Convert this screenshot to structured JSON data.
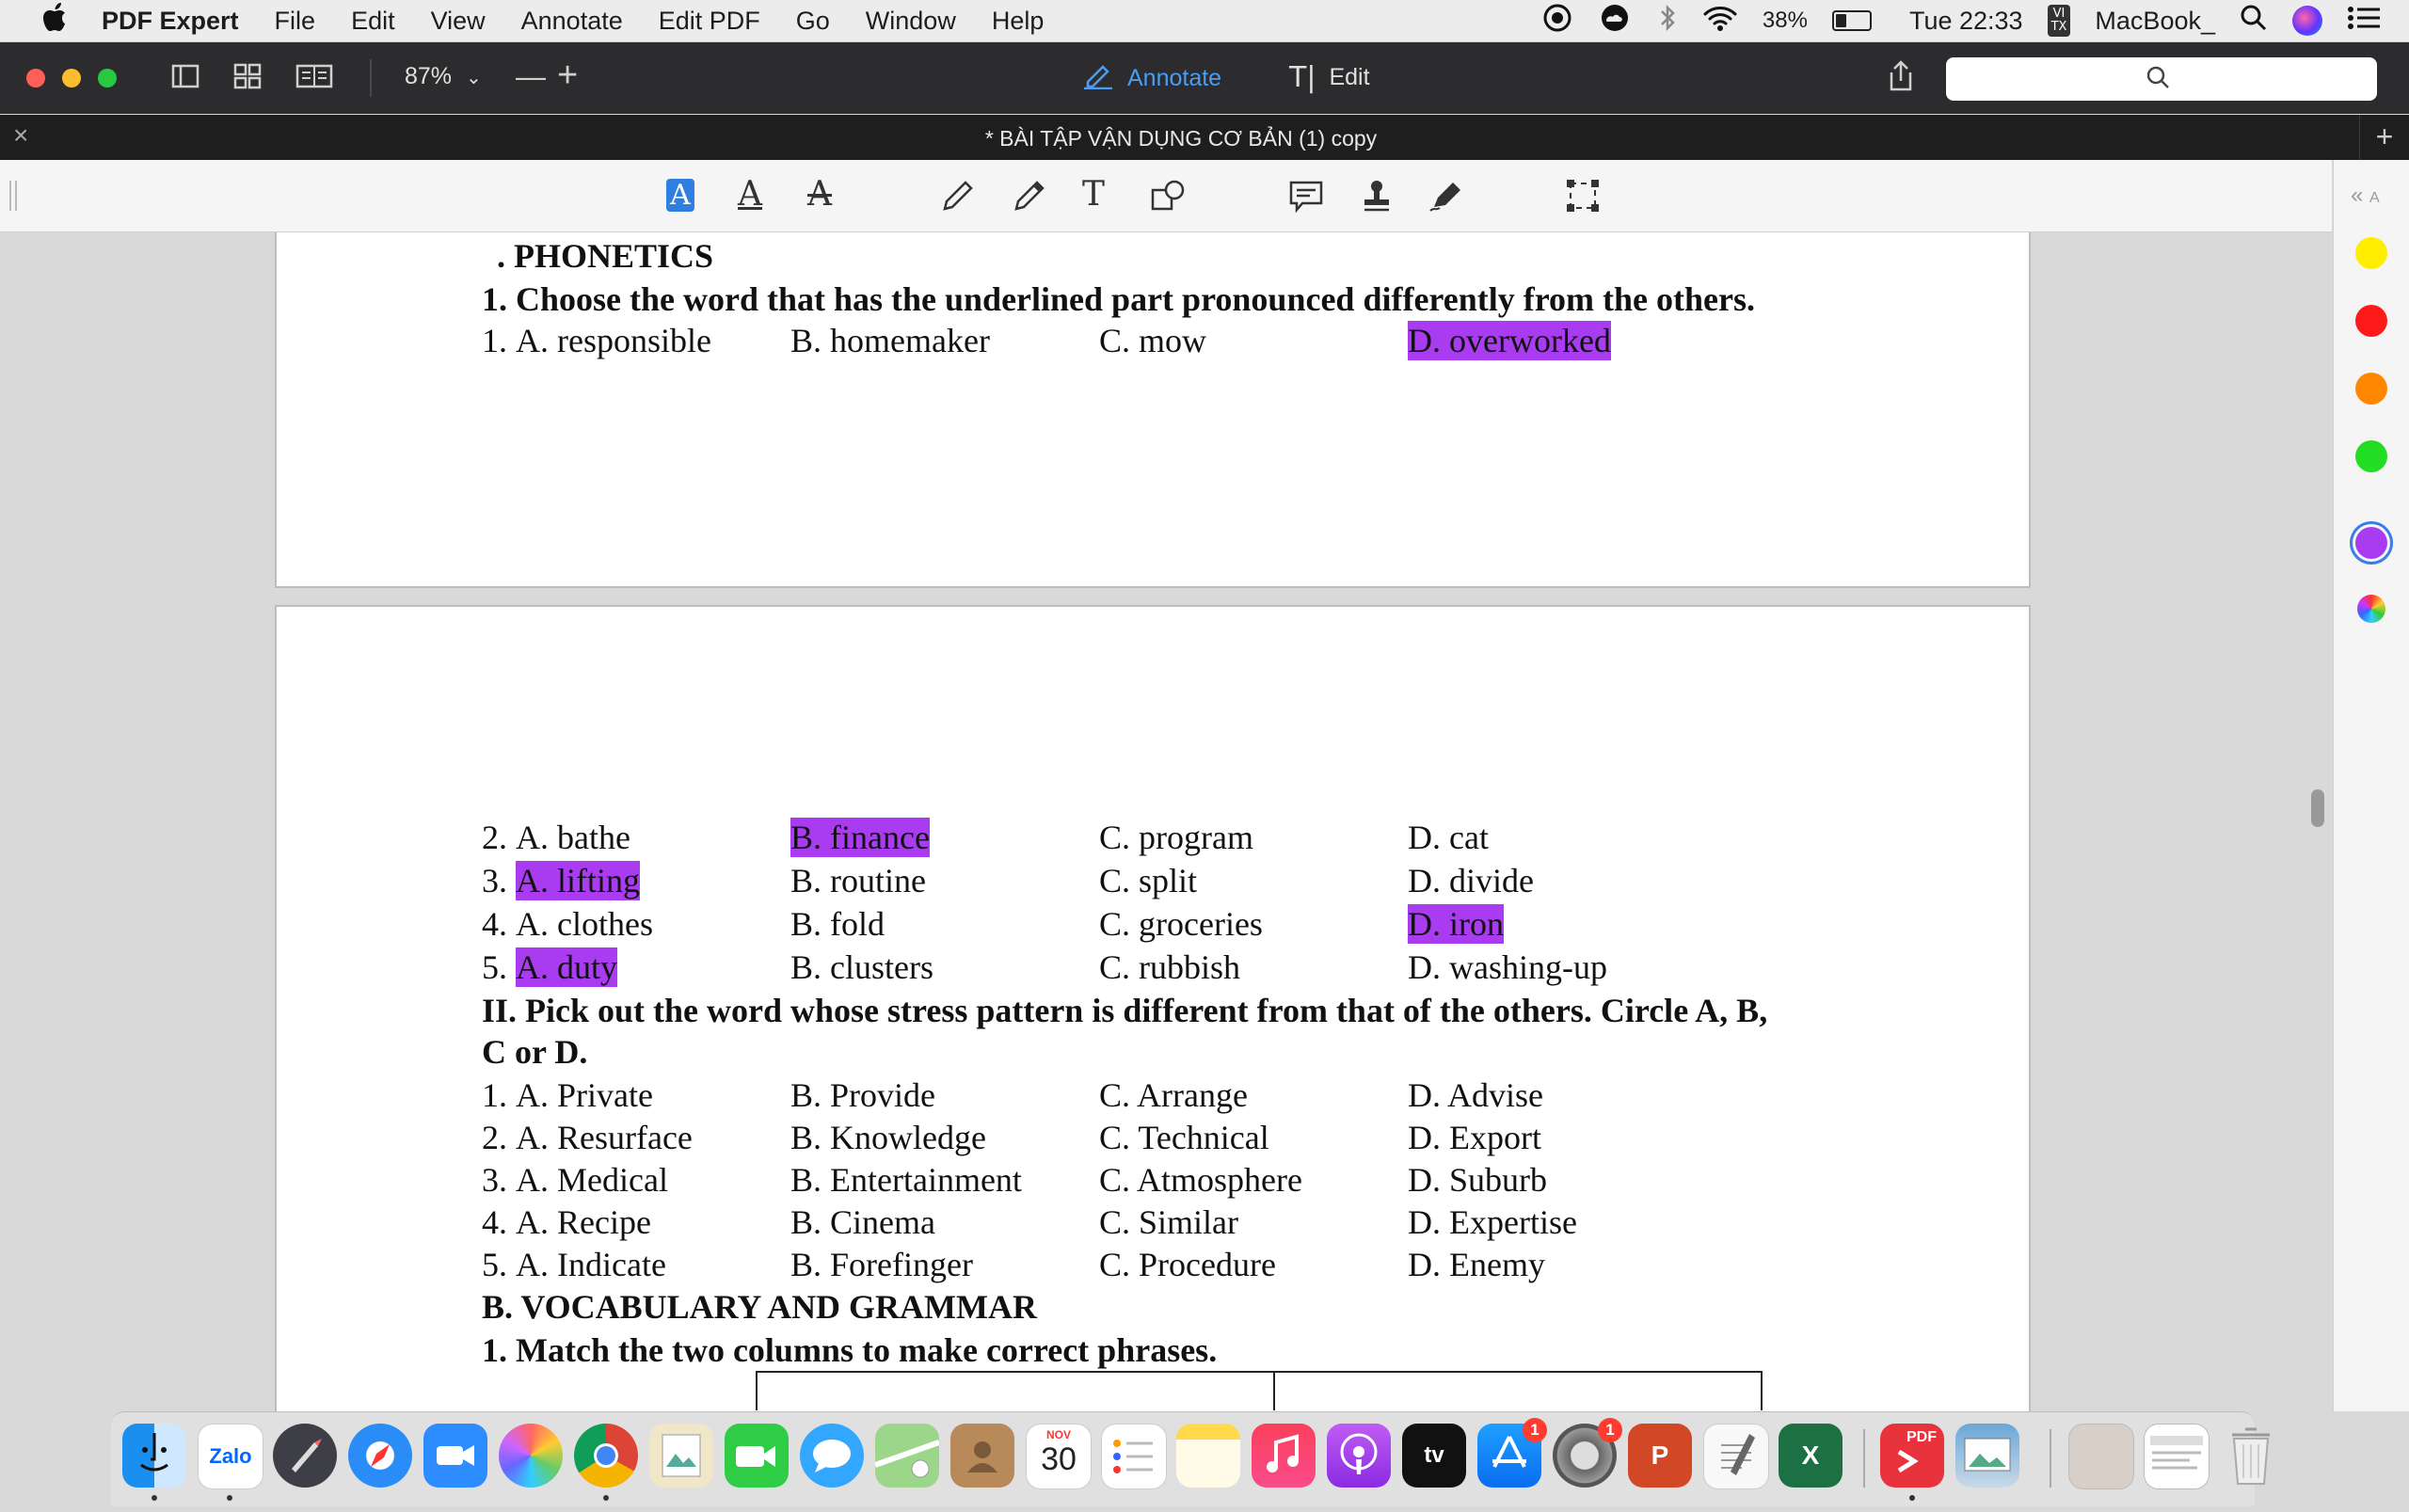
{
  "menubar": {
    "apple": "",
    "items": [
      "PDF Expert",
      "File",
      "Edit",
      "View",
      "Annotate",
      "Edit PDF",
      "Go",
      "Window",
      "Help"
    ],
    "battery_percent": "38%",
    "battery_level": 0.38,
    "clock": "Tue 22:33",
    "input_badge": "VI\nTX",
    "user": "MacBook_"
  },
  "toolbar": {
    "zoom": "87%",
    "annotate_label": "Annotate",
    "edit_label": "Edit",
    "search_placeholder": ""
  },
  "tab": {
    "title": "* BÀI TẬP VẬN DỤNG CƠ BẢN (1) copy"
  },
  "annotation_tools": [
    "text-highlight",
    "text-underline",
    "text-strikethrough",
    "pencil",
    "eraser",
    "text",
    "shapes",
    "note",
    "stamp",
    "signature",
    "area-select"
  ],
  "colors": [
    {
      "name": "yellow",
      "hex": "#ffee00"
    },
    {
      "name": "red",
      "hex": "#ff1a1a"
    },
    {
      "name": "orange",
      "hex": "#ff8800"
    },
    {
      "name": "green",
      "hex": "#22dd22"
    },
    {
      "name": "purple",
      "hex": "#a93cf0",
      "selected": true
    },
    {
      "name": "custom",
      "hex": "multicolor"
    }
  ],
  "document": {
    "page1": {
      "heading": ". PHONETICS",
      "instruction": "1. Choose the word that has the underlined part pronounced differently from the others.",
      "q1": {
        "n": "1.",
        "a": "A. responsible",
        "b": "B. homemaker",
        "c": "C. mow",
        "d": "D. overworked"
      }
    },
    "page2": {
      "questions": [
        {
          "n": "2.",
          "a": "A. bathe",
          "b": "B. finance",
          "c": "C. program",
          "d": "D. cat"
        },
        {
          "n": "3.",
          "a": "A. lifting",
          "b": "B. routine",
          "c": "C. split",
          "d": "D. divide"
        },
        {
          "n": "4.",
          "a": "A. clothes",
          "b": "B. fold",
          "c": "C. groceries",
          "d": "D. iron"
        },
        {
          "n": "5.",
          "a": "A. duty",
          "b": "B. clusters",
          "c": "C. rubbish",
          "d": "D. washing-up"
        }
      ],
      "section2_title_line1": "II. Pick out the word whose stress pattern is different from that of the others. Circle A, B,",
      "section2_title_line2": "C or D.",
      "stress": [
        {
          "n": "1.",
          "a": "A. Private",
          "b": "B. Provide",
          "c": "C. Arrange",
          "d": "D. Advise"
        },
        {
          "n": "2.",
          "a": "A. Resurface",
          "b": "B. Knowledge",
          "c": "C. Technical",
          "d": "D. Export"
        },
        {
          "n": "3.",
          "a": "A. Medical",
          "b": "B. Entertainment",
          "c": "C. Atmosphere",
          "d": "D. Suburb"
        },
        {
          "n": "4.",
          "a": "A. Recipe",
          "b": "B. Cinema",
          "c": "C. Similar",
          "d": "D. Expertise"
        },
        {
          "n": "5.",
          "a": "A. Indicate",
          "b": "B. Forefinger",
          "c": "C. Procedure",
          "d": "D. Enemy"
        }
      ],
      "sectionB": "B. VOCABULARY AND GRAMMAR",
      "sectionB_instruction": "1. Match the two columns to make correct phrases."
    }
  },
  "dock": {
    "apps": [
      "Finder",
      "Zalo",
      "Launchpad",
      "Safari",
      "Zoom",
      "Photos",
      "Chrome",
      "Preview",
      "FaceTime",
      "Messages",
      "Maps",
      "Contacts",
      "Calendar",
      "Reminders",
      "Notes",
      "Music",
      "Podcasts",
      "TV",
      "App Store",
      "System Preferences",
      "PowerPoint",
      "TextEdit",
      "Excel",
      "PDF Expert",
      "Image Capture",
      "Documents",
      "Downloads",
      "Trash"
    ],
    "calendar_month": "NOV",
    "calendar_day": "30",
    "zalo_label": "Zalo",
    "tv_label": "tv",
    "pdf_label": "PDF",
    "appstore_badge": "1",
    "sysprefs_badge": "1"
  }
}
